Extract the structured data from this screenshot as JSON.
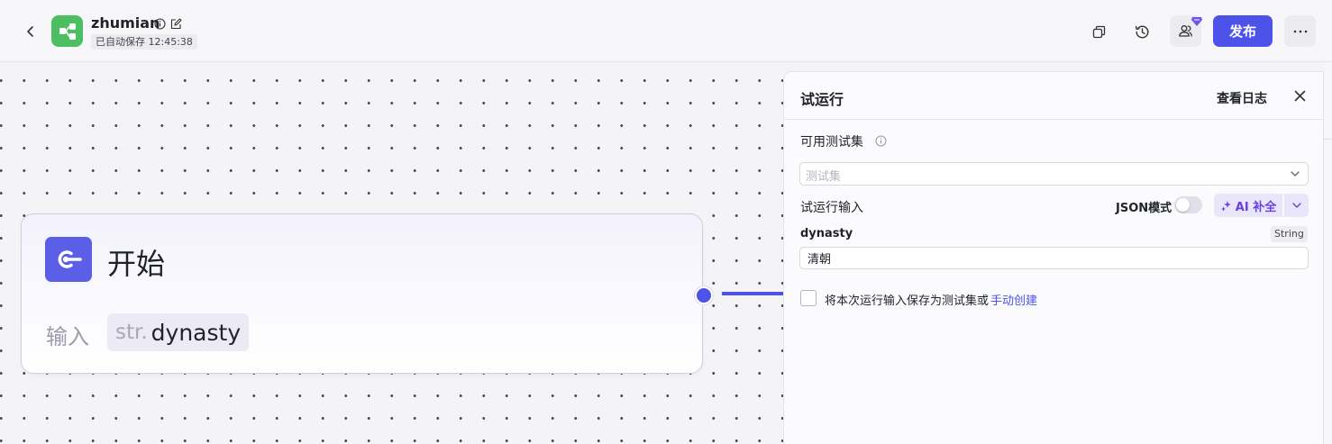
{
  "header": {
    "app_name": "zhumian",
    "save_status": "已自动保存 12:45:38",
    "publish_label": "发布",
    "brand_color": "#4d53e8",
    "logo_color": "#4cbf63",
    "icons": [
      "chevron-left-icon",
      "info-icon",
      "edit-icon",
      "copy-icon",
      "history-icon",
      "users-icon",
      "more-icon"
    ]
  },
  "canvas": {
    "start_node": {
      "title": "开始",
      "input_label": "输入",
      "param_type": "str.",
      "param_name": "dynasty"
    }
  },
  "panel": {
    "title": "试运行",
    "view_log": "查看日志",
    "testset_label": "可用测试集",
    "testset_placeholder": "测试集",
    "input_section": "试运行输入",
    "json_mode": "JSON模式",
    "ai_fill": "AI 补全",
    "field": {
      "name": "dynasty",
      "type": "String",
      "value": "清朝"
    },
    "save_text": "将本次运行输入保存为测试集或",
    "manual_create": "手动创建"
  }
}
